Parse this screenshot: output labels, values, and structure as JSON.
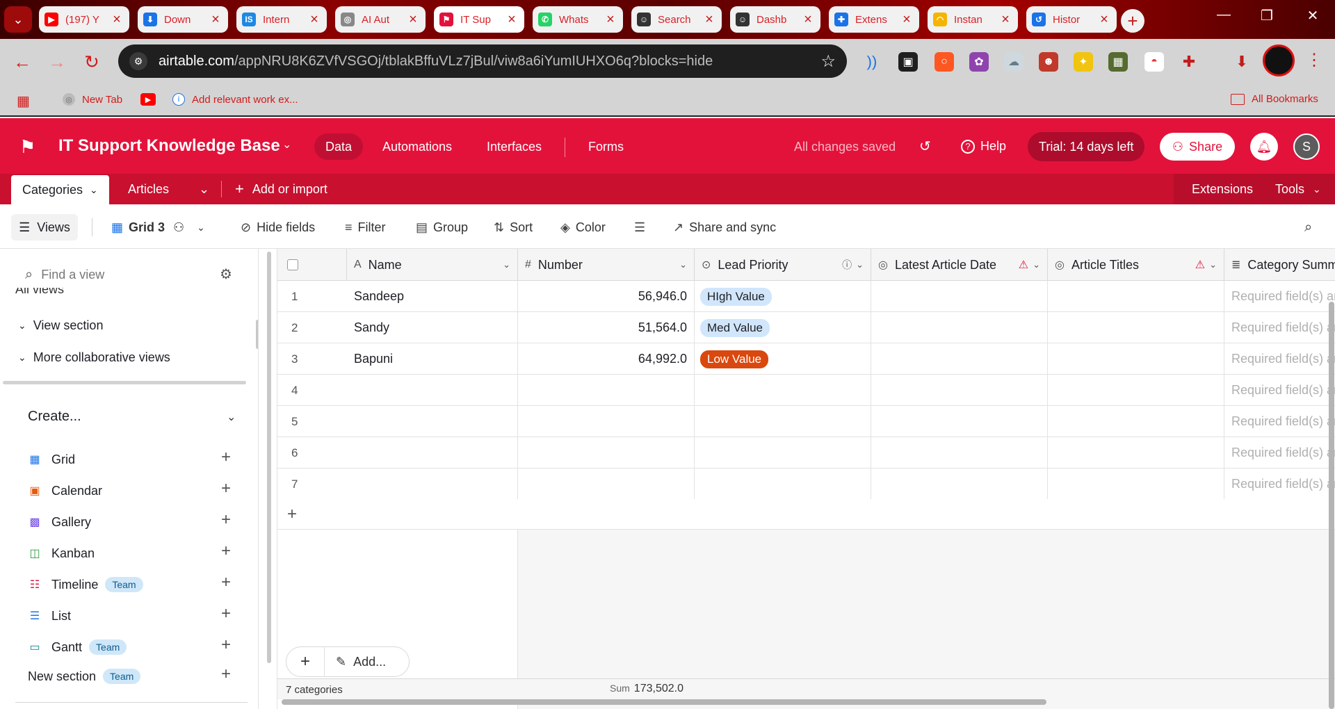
{
  "browser": {
    "tabs": [
      {
        "title": "(197) Y",
        "fav": "yt",
        "color": "#ff0000",
        "glyph": "▶"
      },
      {
        "title": "Down",
        "fav": "download",
        "color": "#1a73e8",
        "glyph": "⬇"
      },
      {
        "title": "Intern",
        "fav": "is",
        "color": "#1e88e5",
        "glyph": "IS"
      },
      {
        "title": "AI Aut",
        "fav": "globe",
        "color": "#888888",
        "glyph": "◎"
      },
      {
        "title": "IT Sup",
        "fav": "airtable",
        "color": "#e3123b",
        "glyph": "⚑"
      },
      {
        "title": "Whats",
        "fav": "whatsapp",
        "color": "#25d366",
        "glyph": "✆"
      },
      {
        "title": "Search",
        "fav": "ghost",
        "color": "#333333",
        "glyph": "☺"
      },
      {
        "title": "Dashb",
        "fav": "ghost",
        "color": "#333333",
        "glyph": "☺"
      },
      {
        "title": "Extens",
        "fav": "puzzle",
        "color": "#1a73e8",
        "glyph": "✚"
      },
      {
        "title": "Instan",
        "fav": "rainbow",
        "color": "#f4b400",
        "glyph": "◠"
      },
      {
        "title": "Histor",
        "fav": "history",
        "color": "#1a73e8",
        "glyph": "↺"
      }
    ],
    "url_host": "airtable.com",
    "url_path": "/appNRU8K6ZVfVSGOj/tblakBffuVLz7jBul/viw8a6iYumIUHXO6q?blocks=hide",
    "bookmarks": {
      "new_tab": "New Tab",
      "work": "Add relevant work ex...",
      "all": "All Bookmarks"
    }
  },
  "header": {
    "base_name": "IT Support Knowledge Base",
    "nav": [
      "Data",
      "Automations",
      "Interfaces",
      "Forms"
    ],
    "saved": "All changes saved",
    "help": "Help",
    "trial": "Trial: 14 days left",
    "share": "Share",
    "avatar": "S"
  },
  "tables": {
    "active": "Categories",
    "other": "Articles",
    "add": "Add or import",
    "extensions": "Extensions",
    "tools": "Tools"
  },
  "viewbar": {
    "views": "Views",
    "grid_name": "Grid 3",
    "hide_fields": "Hide fields",
    "filter": "Filter",
    "group": "Group",
    "sort": "Sort",
    "color": "Color",
    "share_sync": "Share and sync"
  },
  "sidebar": {
    "find_placeholder": "Find a view",
    "all_views": "All views",
    "sections": [
      "View section",
      "More collaborative views"
    ],
    "create": "Create...",
    "create_items": [
      {
        "label": "Grid",
        "icon": "grid-icon",
        "badge": ""
      },
      {
        "label": "Calendar",
        "icon": "calendar-icon",
        "badge": ""
      },
      {
        "label": "Gallery",
        "icon": "gallery-icon",
        "badge": ""
      },
      {
        "label": "Kanban",
        "icon": "kanban-icon",
        "badge": ""
      },
      {
        "label": "Timeline",
        "icon": "timeline-icon",
        "badge": "Team"
      },
      {
        "label": "List",
        "icon": "list-icon",
        "badge": ""
      },
      {
        "label": "Gantt",
        "icon": "gantt-icon",
        "badge": "Team"
      }
    ],
    "new_section": "New section",
    "new_section_badge": "Team"
  },
  "grid": {
    "columns": [
      "Name",
      "Number",
      "Lead Priority",
      "Latest Article Date",
      "Article Titles",
      "Category Summ"
    ],
    "rows": [
      {
        "n": "1",
        "name": "Sandeep",
        "number": "56,946.0",
        "priority": "HIgh Value",
        "style": "blue"
      },
      {
        "n": "2",
        "name": "Sandy",
        "number": "51,564.0",
        "priority": "Med Value",
        "style": "blue"
      },
      {
        "n": "3",
        "name": "Bapuni",
        "number": "64,992.0",
        "priority": "Low Value",
        "style": "orange"
      },
      {
        "n": "4",
        "name": "",
        "number": "",
        "priority": "",
        "style": ""
      },
      {
        "n": "5",
        "name": "",
        "number": "",
        "priority": "",
        "style": ""
      },
      {
        "n": "6",
        "name": "",
        "number": "",
        "priority": "",
        "style": ""
      },
      {
        "n": "7",
        "name": "",
        "number": "",
        "priority": "",
        "style": ""
      }
    ],
    "required_text": "Required field(s) are",
    "add_label": "Add...",
    "count_label": "7 categories",
    "sum_label": "Sum",
    "sum_value": "173,502.0"
  },
  "colors": {
    "brand": "#e3123b",
    "brand_dark": "#c9102f"
  }
}
